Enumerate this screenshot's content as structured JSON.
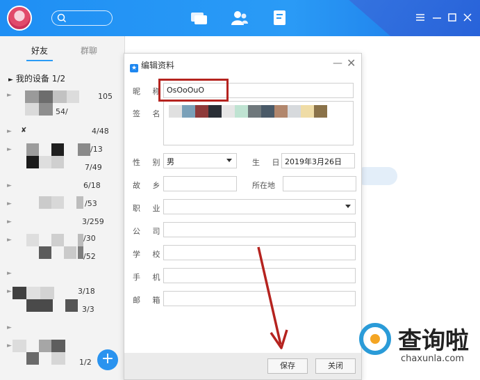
{
  "sidebar": {
    "tabs": [
      "好友",
      "群聊"
    ],
    "group_title": "我的设备",
    "group_count": "1/2",
    "row_counts": [
      "105",
      "54/",
      "4/48",
      "/13",
      "7/49",
      "6/18",
      "/53",
      "3/259",
      "/30",
      "/52",
      "3/18",
      "3/3",
      "1/2"
    ],
    "fab_label": "+"
  },
  "dialog": {
    "title": "编辑资料",
    "nickname_label": "昵 称",
    "nickname_value": "OsOoOuO",
    "signature_label": "签 名",
    "gender_label": "性 别",
    "gender_value": "男",
    "birthday_label": "生 日",
    "birthday_value": "2019年3月26日",
    "hometown_label": "故 乡",
    "location_label": "所在地",
    "job_label": "职 业",
    "company_label": "公 司",
    "school_label": "学 校",
    "phone_label": "手 机",
    "email_label": "邮 箱",
    "save_label": "保存",
    "close_label": "关闭"
  },
  "watermark": {
    "brand": "查询啦",
    "url": "chaxunla.com"
  },
  "colors": {
    "accent": "#2a9bf6",
    "annotation": "#b5231f"
  }
}
